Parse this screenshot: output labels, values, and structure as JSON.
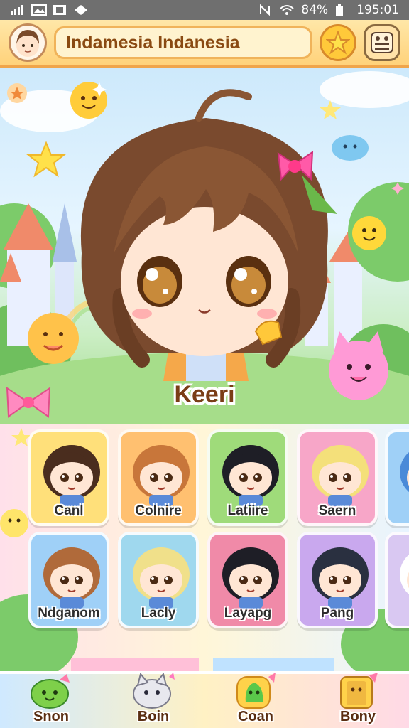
{
  "status_bar": {
    "battery": "84%",
    "time": "195:01"
  },
  "header": {
    "title": "Indamesia Indanesia",
    "avatar_icon": "player-avatar",
    "star_icon": "star-icon",
    "menu_icon": "menu-icon"
  },
  "hero": {
    "name": "Keeri"
  },
  "roster": {
    "cards": [
      {
        "label": "Canl",
        "color": "#ffe07a",
        "hair": "#4a2d1e"
      },
      {
        "label": "Colnire",
        "color": "#ffc070",
        "hair": "#c8763a"
      },
      {
        "label": "Latiire",
        "color": "#9fdb7a",
        "hair": "#1e1e26"
      },
      {
        "label": "Saern",
        "color": "#f7a6c8",
        "hair": "#f4e07a"
      },
      {
        "label": "",
        "color": "#9fd0f7",
        "hair": "#4a8ad8"
      },
      {
        "label": "Ndganom",
        "color": "#9fd0f7",
        "hair": "#b06a3a"
      },
      {
        "label": "Lacly",
        "color": "#9fd8ee",
        "hair": "#f0e08a"
      },
      {
        "label": "Layapg",
        "color": "#f08aa8",
        "hair": "#1e1e26"
      },
      {
        "label": "Pang",
        "color": "#c9a8ee",
        "hair": "#2a3040"
      },
      {
        "label": "",
        "color": "#d9c8f2",
        "hair": "#ffffff"
      }
    ]
  },
  "nav": {
    "items": [
      {
        "label": "Snon",
        "icon": "green-blob-icon"
      },
      {
        "label": "Boin",
        "icon": "cat-icon"
      },
      {
        "label": "Coan",
        "icon": "coin-leaf-icon"
      },
      {
        "label": "Bony",
        "icon": "box-icon"
      }
    ]
  }
}
